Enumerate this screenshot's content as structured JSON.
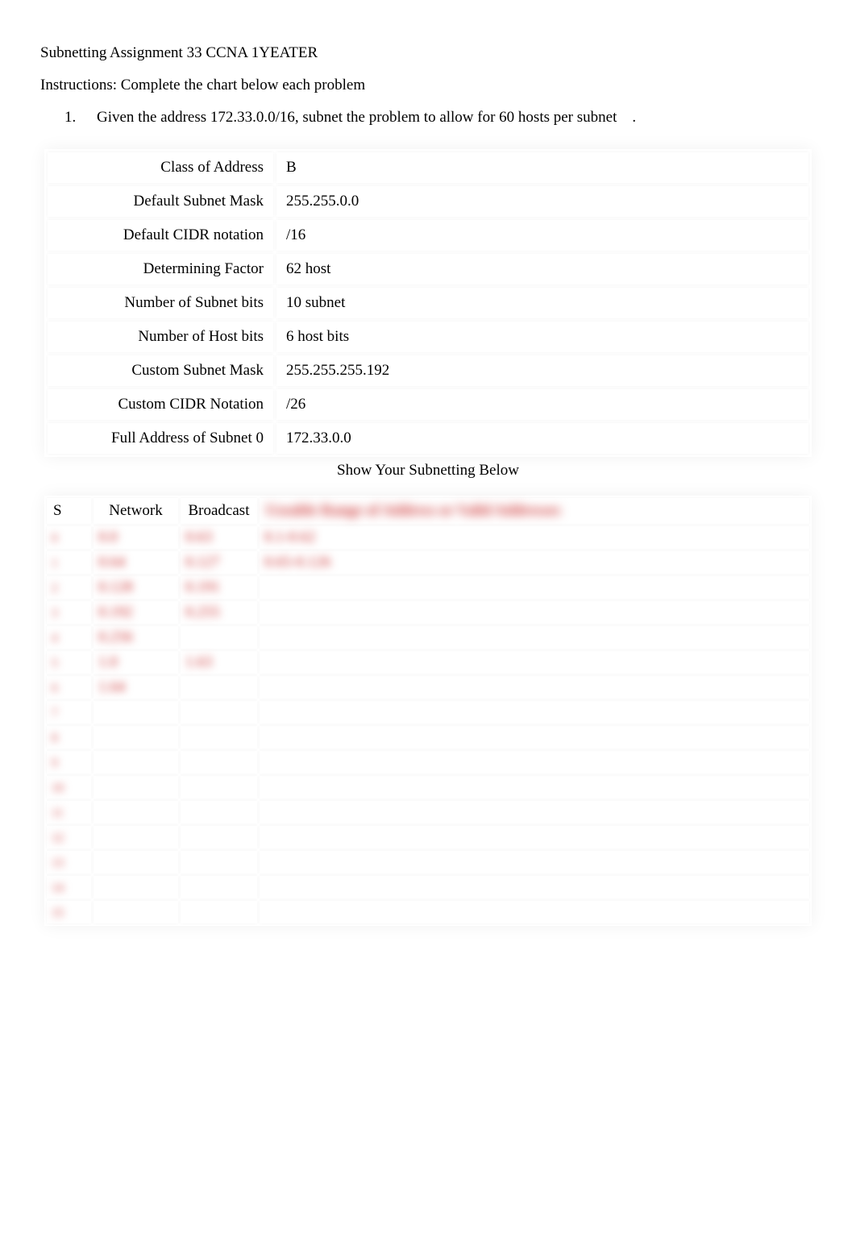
{
  "title": "Subnetting Assignment 33 CCNA 1YEATER",
  "instructions": "Instructions: Complete the chart below each problem",
  "problem": {
    "number": "1.",
    "text": "Given the address 172.33.0.0/16, subnet the problem to allow for 60 hosts per subnet ."
  },
  "info_rows": [
    {
      "label": "Class of Address",
      "value": "B"
    },
    {
      "label": "Default Subnet Mask",
      "value": "255.255.0.0"
    },
    {
      "label": "Default CIDR notation",
      "value": "/16"
    },
    {
      "label": "Determining Factor",
      "value": "62 host"
    },
    {
      "label": "Number of Subnet bits",
      "value": "10 subnet"
    },
    {
      "label": "Number of Host bits",
      "value": "6 host bits"
    },
    {
      "label": "Custom Subnet Mask",
      "value": "255.255.255.192"
    },
    {
      "label": "Custom CIDR Notation",
      "value": "/26"
    },
    {
      "label": "Full Address of Subnet 0",
      "value": "172.33.0.0"
    }
  ],
  "show_heading": "Show Your Subnetting Below",
  "work_headers": {
    "s": "S",
    "network": "Network",
    "broadcast": "Broadcast",
    "range_blurred": "Useable Range of Address or Valid Addresses"
  },
  "work_rows": [
    {
      "s": "0",
      "network": "0.0",
      "broadcast": "0.63",
      "range": "0.1-0.62"
    },
    {
      "s": "1",
      "network": "0.64",
      "broadcast": "0.127",
      "range": "0.65-0.126"
    },
    {
      "s": "2",
      "network": "0.128",
      "broadcast": "0.191",
      "range": ""
    },
    {
      "s": "3",
      "network": "0.192",
      "broadcast": "0.255",
      "range": ""
    },
    {
      "s": "4",
      "network": "0.256",
      "broadcast": "",
      "range": ""
    },
    {
      "s": "5",
      "network": "1.0",
      "broadcast": "1.63",
      "range": ""
    },
    {
      "s": "6",
      "network": "1.64",
      "broadcast": "",
      "range": ""
    },
    {
      "s": "7",
      "network": "",
      "broadcast": "",
      "range": ""
    },
    {
      "s": "8",
      "network": "",
      "broadcast": "",
      "range": ""
    },
    {
      "s": "9",
      "network": "",
      "broadcast": "",
      "range": ""
    },
    {
      "s": "10",
      "network": "",
      "broadcast": "",
      "range": ""
    },
    {
      "s": "11",
      "network": "",
      "broadcast": "",
      "range": ""
    },
    {
      "s": "12",
      "network": "",
      "broadcast": "",
      "range": ""
    },
    {
      "s": "13",
      "network": "",
      "broadcast": "",
      "range": ""
    },
    {
      "s": "14",
      "network": "",
      "broadcast": "",
      "range": ""
    },
    {
      "s": "15",
      "network": "",
      "broadcast": "",
      "range": ""
    }
  ]
}
